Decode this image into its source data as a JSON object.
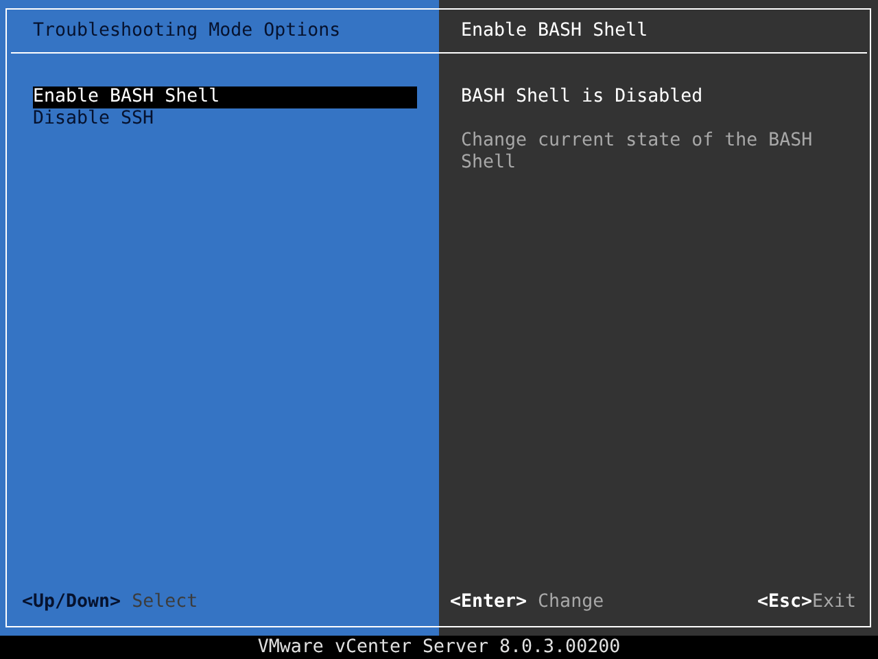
{
  "left_panel": {
    "title": "Troubleshooting Mode Options",
    "items": [
      {
        "label": "Enable BASH Shell",
        "selected": true
      },
      {
        "label": "Disable SSH",
        "selected": false
      }
    ],
    "hints": [
      {
        "key": "<Up/Down>",
        "action": "Select"
      }
    ]
  },
  "right_panel": {
    "title": "Enable BASH Shell",
    "status": "BASH Shell is Disabled",
    "description": "Change current state of the BASH Shell",
    "hints": [
      {
        "key": "<Enter>",
        "action": "Change"
      },
      {
        "key": "<Esc>",
        "action": "Exit"
      }
    ]
  },
  "status_bar": "VMware vCenter Server 8.0.3.00200"
}
